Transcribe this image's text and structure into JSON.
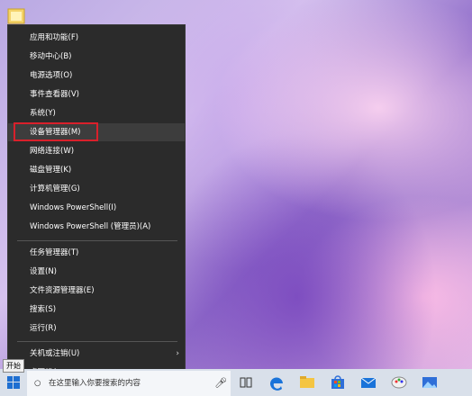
{
  "context_menu": {
    "items": [
      {
        "label": "应用和功能(F)"
      },
      {
        "label": "移动中心(B)"
      },
      {
        "label": "电源选项(O)"
      },
      {
        "label": "事件查看器(V)"
      },
      {
        "label": "系统(Y)"
      },
      {
        "label": "设备管理器(M)"
      },
      {
        "label": "网络连接(W)"
      },
      {
        "label": "磁盘管理(K)"
      },
      {
        "label": "计算机管理(G)"
      },
      {
        "label": "Windows PowerShell(I)"
      },
      {
        "label": "Windows PowerShell (管理员)(A)"
      },
      {
        "label": "任务管理器(T)"
      },
      {
        "label": "设置(N)"
      },
      {
        "label": "文件资源管理器(E)"
      },
      {
        "label": "搜索(S)"
      },
      {
        "label": "运行(R)"
      },
      {
        "label": "关机或注销(U)"
      },
      {
        "label": "桌面(D)"
      }
    ],
    "highlighted_item": "设备管理器(M)"
  },
  "tooltip": {
    "text": "开始"
  },
  "taskbar": {
    "search_placeholder": "在这里输入你要搜索的内容",
    "icons": [
      "cortana-mic-icon",
      "task-view-icon",
      "edge-icon",
      "file-explorer-icon",
      "store-icon",
      "mail-icon",
      "paint-icon",
      "photos-icon"
    ]
  },
  "colors": {
    "menu_bg": "#2b2b2b",
    "highlight_border": "#d9202b",
    "taskbar_bg": "#d9e0ea"
  }
}
